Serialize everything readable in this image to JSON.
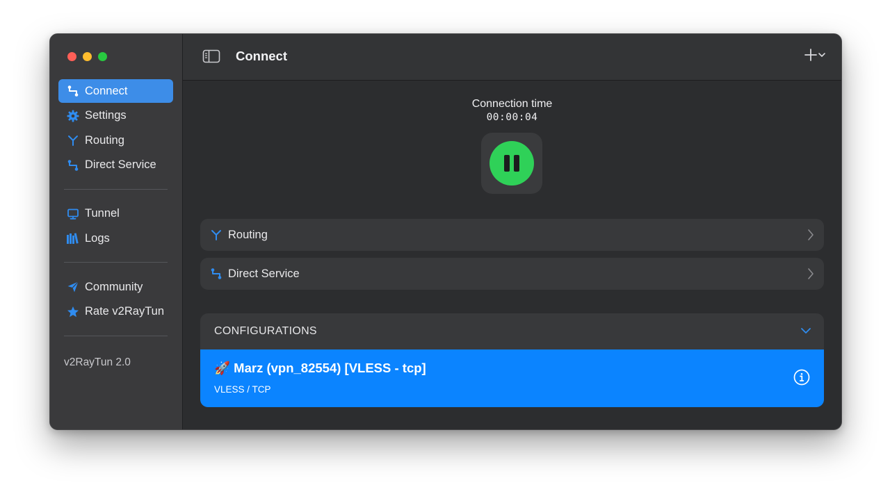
{
  "sidebar": {
    "items": [
      {
        "label": "Connect",
        "icon": "connect-icon",
        "active": true
      },
      {
        "label": "Settings",
        "icon": "gear-icon"
      },
      {
        "label": "Routing",
        "icon": "routing-icon"
      },
      {
        "label": "Direct Service",
        "icon": "direct-service-icon"
      },
      {
        "label": "Tunnel",
        "icon": "monitor-icon"
      },
      {
        "label": "Logs",
        "icon": "logs-icon"
      },
      {
        "label": "Community",
        "icon": "paper-plane-icon"
      },
      {
        "label": "Rate v2RayTun",
        "icon": "star-icon"
      }
    ],
    "version": "v2RayTun 2.0"
  },
  "header": {
    "title": "Connect"
  },
  "connection": {
    "label": "Connection time",
    "time": "00:00:04",
    "status_color": "#2fd158"
  },
  "rows": {
    "routing": "Routing",
    "direct_service": "Direct Service"
  },
  "configurations": {
    "header": "CONFIGURATIONS",
    "items": [
      {
        "name": "🚀 Marz (vpn_82554) [VLESS - tcp]",
        "protocol": "VLESS / TCP",
        "selected": true
      }
    ]
  },
  "colors": {
    "accent": "#0b84ff",
    "sidebar_active": "#3d8de8",
    "icon_blue": "#2f8cf0"
  }
}
